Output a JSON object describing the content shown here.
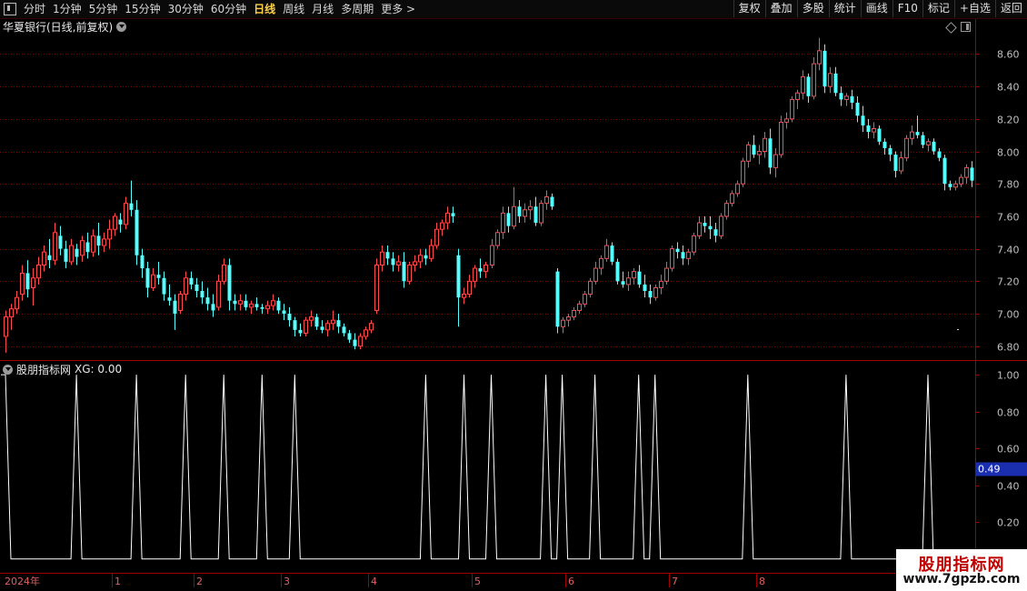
{
  "toolbar": {
    "periods": [
      "分时",
      "1分钟",
      "5分钟",
      "15分钟",
      "30分钟",
      "60分钟",
      "日线",
      "周线",
      "月线",
      "多周期",
      "更多 >"
    ],
    "active_period": "日线",
    "buttons": [
      "复权",
      "叠加",
      "多股",
      "统计",
      "画线",
      "F10",
      "标记",
      "+自选",
      "返回"
    ]
  },
  "main_panel": {
    "title": "华夏银行(日线,前复权)"
  },
  "indicator_panel": {
    "name": "股朋指标网",
    "value_label": "XG: 0.00",
    "current_value": "0.49"
  },
  "watermark": {
    "title": "股朋指标网",
    "url": "www.7gpzb.com"
  },
  "colors": {
    "up": "#ff4b4b",
    "down": "#54ffff",
    "grid": "#7a0000",
    "axis_text": "#c0c0c0",
    "signal": "#ffffff",
    "value_badge": "#1a2fb0"
  },
  "chart_data": [
    {
      "type": "candlestick",
      "title": "华夏银行(日线,前复权)",
      "y_ticks": [
        "8.60",
        "8.40",
        "8.20",
        "8.00",
        "7.80",
        "7.60",
        "7.40",
        "7.20",
        "7.00",
        "6.80"
      ],
      "ylim": [
        6.72,
        8.72
      ],
      "grid": true,
      "ohlc": [
        [
          6.86,
          7.02,
          6.76,
          6.98
        ],
        [
          6.98,
          7.06,
          6.9,
          7.03
        ],
        [
          7.03,
          7.14,
          7.0,
          7.1
        ],
        [
          7.12,
          7.3,
          7.08,
          7.25
        ],
        [
          7.25,
          7.33,
          7.1,
          7.15
        ],
        [
          7.16,
          7.28,
          7.05,
          7.22
        ],
        [
          7.22,
          7.35,
          7.18,
          7.3
        ],
        [
          7.3,
          7.42,
          7.26,
          7.38
        ],
        [
          7.36,
          7.46,
          7.28,
          7.33
        ],
        [
          7.33,
          7.56,
          7.3,
          7.5
        ],
        [
          7.48,
          7.54,
          7.36,
          7.4
        ],
        [
          7.4,
          7.45,
          7.28,
          7.32
        ],
        [
          7.32,
          7.46,
          7.3,
          7.42
        ],
        [
          7.4,
          7.43,
          7.3,
          7.35
        ],
        [
          7.36,
          7.48,
          7.32,
          7.45
        ],
        [
          7.44,
          7.5,
          7.34,
          7.38
        ],
        [
          7.38,
          7.52,
          7.35,
          7.48
        ],
        [
          7.48,
          7.56,
          7.36,
          7.42
        ],
        [
          7.42,
          7.5,
          7.38,
          7.46
        ],
        [
          7.46,
          7.58,
          7.4,
          7.52
        ],
        [
          7.52,
          7.62,
          7.48,
          7.6
        ],
        [
          7.58,
          7.62,
          7.5,
          7.55
        ],
        [
          7.55,
          7.72,
          7.52,
          7.68
        ],
        [
          7.68,
          7.82,
          7.6,
          7.64
        ],
        [
          7.64,
          7.7,
          7.3,
          7.36
        ],
        [
          7.36,
          7.4,
          7.22,
          7.28
        ],
        [
          7.28,
          7.32,
          7.1,
          7.16
        ],
        [
          7.16,
          7.28,
          7.14,
          7.24
        ],
        [
          7.24,
          7.32,
          7.18,
          7.22
        ],
        [
          7.22,
          7.26,
          7.08,
          7.12
        ],
        [
          7.1,
          7.18,
          7.05,
          7.08
        ],
        [
          7.08,
          7.12,
          6.9,
          7.0
        ],
        [
          7.02,
          7.14,
          7.0,
          7.12
        ],
        [
          7.12,
          7.26,
          7.08,
          7.22
        ],
        [
          7.22,
          7.26,
          7.15,
          7.18
        ],
        [
          7.18,
          7.22,
          7.1,
          7.14
        ],
        [
          7.14,
          7.2,
          7.06,
          7.1
        ],
        [
          7.1,
          7.16,
          7.02,
          7.06
        ],
        [
          7.06,
          7.12,
          6.98,
          7.02
        ],
        [
          7.04,
          7.24,
          7.02,
          7.2
        ],
        [
          7.2,
          7.34,
          7.18,
          7.3
        ],
        [
          7.3,
          7.34,
          7.02,
          7.08
        ],
        [
          7.08,
          7.12,
          7.02,
          7.06
        ],
        [
          7.06,
          7.12,
          7.02,
          7.08
        ],
        [
          7.08,
          7.12,
          7.02,
          7.04
        ],
        [
          7.04,
          7.08,
          7.0,
          7.06
        ],
        [
          7.06,
          7.1,
          7.02,
          7.04
        ],
        [
          7.04,
          7.06,
          7.0,
          7.03
        ],
        [
          7.03,
          7.08,
          7.0,
          7.05
        ],
        [
          7.05,
          7.12,
          7.02,
          7.08
        ],
        [
          7.08,
          7.1,
          7.0,
          7.02
        ],
        [
          7.02,
          7.06,
          6.96,
          7.0
        ],
        [
          7.0,
          7.04,
          6.92,
          6.96
        ],
        [
          6.96,
          6.98,
          6.86,
          6.9
        ],
        [
          6.9,
          6.94,
          6.86,
          6.88
        ],
        [
          6.88,
          6.98,
          6.86,
          6.96
        ],
        [
          6.96,
          7.02,
          6.92,
          6.98
        ],
        [
          6.98,
          7.0,
          6.9,
          6.92
        ],
        [
          6.92,
          6.96,
          6.88,
          6.9
        ],
        [
          6.9,
          6.96,
          6.86,
          6.94
        ],
        [
          6.94,
          7.02,
          6.9,
          6.96
        ],
        [
          6.96,
          7.0,
          6.88,
          6.92
        ],
        [
          6.92,
          6.94,
          6.86,
          6.88
        ],
        [
          6.88,
          6.9,
          6.82,
          6.84
        ],
        [
          6.84,
          6.88,
          6.78,
          6.8
        ],
        [
          6.8,
          6.88,
          6.78,
          6.86
        ],
        [
          6.86,
          6.92,
          6.84,
          6.9
        ],
        [
          6.9,
          6.96,
          6.88,
          6.94
        ],
        [
          7.02,
          7.34,
          7.0,
          7.3
        ],
        [
          7.3,
          7.42,
          7.26,
          7.38
        ],
        [
          7.38,
          7.42,
          7.3,
          7.34
        ],
        [
          7.34,
          7.38,
          7.26,
          7.3
        ],
        [
          7.3,
          7.36,
          7.26,
          7.32
        ],
        [
          7.32,
          7.38,
          7.16,
          7.2
        ],
        [
          7.2,
          7.32,
          7.18,
          7.3
        ],
        [
          7.3,
          7.36,
          7.26,
          7.32
        ],
        [
          7.32,
          7.4,
          7.28,
          7.36
        ],
        [
          7.36,
          7.4,
          7.3,
          7.34
        ],
        [
          7.34,
          7.46,
          7.32,
          7.42
        ],
        [
          7.42,
          7.56,
          7.4,
          7.52
        ],
        [
          7.52,
          7.58,
          7.48,
          7.56
        ],
        [
          7.56,
          7.66,
          7.52,
          7.62
        ],
        [
          7.62,
          7.66,
          7.56,
          7.6
        ],
        [
          7.36,
          7.4,
          6.92,
          7.1
        ],
        [
          7.1,
          7.16,
          7.06,
          7.12
        ],
        [
          7.12,
          7.24,
          7.1,
          7.2
        ],
        [
          7.2,
          7.3,
          7.16,
          7.28
        ],
        [
          7.28,
          7.34,
          7.22,
          7.26
        ],
        [
          7.26,
          7.32,
          7.22,
          7.3
        ],
        [
          7.3,
          7.46,
          7.28,
          7.42
        ],
        [
          7.42,
          7.52,
          7.4,
          7.5
        ],
        [
          7.5,
          7.66,
          7.46,
          7.62
        ],
        [
          7.62,
          7.66,
          7.5,
          7.54
        ],
        [
          7.54,
          7.78,
          7.52,
          7.66
        ],
        [
          7.66,
          7.7,
          7.56,
          7.6
        ],
        [
          7.6,
          7.68,
          7.56,
          7.64
        ],
        [
          7.64,
          7.7,
          7.58,
          7.66
        ],
        [
          7.66,
          7.72,
          7.54,
          7.56
        ],
        [
          7.56,
          7.7,
          7.54,
          7.68
        ],
        [
          7.68,
          7.76,
          7.64,
          7.72
        ],
        [
          7.72,
          7.74,
          7.64,
          7.66
        ],
        [
          7.26,
          7.28,
          6.88,
          6.92
        ],
        [
          6.92,
          6.98,
          6.88,
          6.96
        ],
        [
          6.96,
          7.0,
          6.92,
          6.98
        ],
        [
          6.98,
          7.04,
          6.96,
          7.02
        ],
        [
          7.02,
          7.08,
          7.0,
          7.06
        ],
        [
          7.06,
          7.14,
          7.04,
          7.12
        ],
        [
          7.12,
          7.22,
          7.1,
          7.2
        ],
        [
          7.2,
          7.32,
          7.18,
          7.28
        ],
        [
          7.28,
          7.36,
          7.24,
          7.34
        ],
        [
          7.34,
          7.46,
          7.32,
          7.42
        ],
        [
          7.42,
          7.44,
          7.3,
          7.32
        ],
        [
          7.32,
          7.34,
          7.18,
          7.2
        ],
        [
          7.2,
          7.26,
          7.16,
          7.18
        ],
        [
          7.18,
          7.26,
          7.14,
          7.22
        ],
        [
          7.22,
          7.28,
          7.18,
          7.26
        ],
        [
          7.26,
          7.3,
          7.16,
          7.18
        ],
        [
          7.18,
          7.24,
          7.1,
          7.14
        ],
        [
          7.14,
          7.18,
          7.06,
          7.1
        ],
        [
          7.1,
          7.18,
          7.08,
          7.16
        ],
        [
          7.16,
          7.24,
          7.12,
          7.2
        ],
        [
          7.2,
          7.32,
          7.18,
          7.28
        ],
        [
          7.28,
          7.42,
          7.26,
          7.4
        ],
        [
          7.4,
          7.44,
          7.34,
          7.38
        ],
        [
          7.38,
          7.42,
          7.3,
          7.34
        ],
        [
          7.34,
          7.4,
          7.3,
          7.38
        ],
        [
          7.38,
          7.5,
          7.36,
          7.48
        ],
        [
          7.48,
          7.6,
          7.46,
          7.56
        ],
        [
          7.56,
          7.6,
          7.5,
          7.54
        ],
        [
          7.54,
          7.6,
          7.46,
          7.52
        ],
        [
          7.52,
          7.56,
          7.44,
          7.48
        ],
        [
          7.48,
          7.62,
          7.46,
          7.6
        ],
        [
          7.6,
          7.7,
          7.58,
          7.68
        ],
        [
          7.68,
          7.76,
          7.66,
          7.74
        ],
        [
          7.74,
          7.82,
          7.72,
          7.8
        ],
        [
          7.8,
          7.96,
          7.78,
          7.94
        ],
        [
          7.94,
          8.06,
          7.9,
          8.04
        ],
        [
          8.04,
          8.1,
          7.96,
          7.98
        ],
        [
          7.98,
          8.04,
          7.92,
          8.0
        ],
        [
          8.0,
          8.12,
          7.96,
          8.08
        ],
        [
          8.08,
          8.14,
          7.86,
          7.9
        ],
        [
          7.9,
          8.02,
          7.84,
          7.98
        ],
        [
          7.98,
          8.22,
          7.96,
          8.18
        ],
        [
          8.18,
          8.24,
          8.14,
          8.2
        ],
        [
          8.2,
          8.34,
          8.18,
          8.32
        ],
        [
          8.32,
          8.38,
          8.26,
          8.36
        ],
        [
          8.36,
          8.5,
          8.32,
          8.46
        ],
        [
          8.46,
          8.48,
          8.3,
          8.34
        ],
        [
          8.34,
          8.58,
          8.32,
          8.54
        ],
        [
          8.54,
          8.7,
          8.5,
          8.62
        ],
        [
          8.62,
          8.66,
          8.36,
          8.4
        ],
        [
          8.4,
          8.52,
          8.36,
          8.48
        ],
        [
          8.48,
          8.52,
          8.34,
          8.36
        ],
        [
          8.36,
          8.4,
          8.28,
          8.32
        ],
        [
          8.32,
          8.36,
          8.28,
          8.34
        ],
        [
          8.34,
          8.38,
          8.26,
          8.3
        ],
        [
          8.3,
          8.34,
          8.18,
          8.22
        ],
        [
          8.22,
          8.28,
          8.12,
          8.16
        ],
        [
          8.16,
          8.2,
          8.08,
          8.12
        ],
        [
          8.12,
          8.18,
          8.08,
          8.14
        ],
        [
          8.14,
          8.16,
          8.04,
          8.06
        ],
        [
          8.06,
          8.08,
          7.98,
          8.02
        ],
        [
          8.02,
          8.04,
          7.94,
          7.98
        ],
        [
          7.98,
          8.0,
          7.84,
          7.88
        ],
        [
          7.88,
          8.0,
          7.86,
          7.96
        ],
        [
          7.96,
          8.1,
          7.94,
          8.08
        ],
        [
          8.08,
          8.16,
          8.04,
          8.12
        ],
        [
          8.12,
          8.22,
          8.08,
          8.1
        ],
        [
          8.1,
          8.12,
          8.02,
          8.04
        ],
        [
          8.04,
          8.08,
          8.0,
          8.06
        ],
        [
          8.06,
          8.08,
          7.98,
          8.0
        ],
        [
          8.0,
          8.02,
          7.94,
          7.96
        ],
        [
          7.96,
          7.98,
          7.76,
          7.8
        ],
        [
          7.8,
          7.82,
          7.76,
          7.78
        ],
        [
          7.78,
          7.82,
          7.76,
          7.8
        ],
        [
          7.8,
          7.86,
          7.78,
          7.84
        ],
        [
          7.84,
          7.92,
          7.8,
          7.9
        ],
        [
          7.9,
          7.94,
          7.78,
          7.82
        ]
      ]
    },
    {
      "type": "line",
      "title": "XG",
      "y_ticks": [
        "1.00",
        "0.80",
        "0.60",
        "0.40",
        "0.20"
      ],
      "ylim": [
        -0.06,
        1.04
      ],
      "x_labels": [
        "2024年",
        "1",
        "2",
        "3",
        "4",
        "5",
        "6",
        "7",
        "8"
      ],
      "signal_days": [
        0,
        13,
        24,
        33,
        40,
        47,
        53,
        77,
        84,
        89,
        99,
        102,
        108,
        116,
        119,
        136,
        154,
        169
      ],
      "series": [
        {
          "values_default": 0,
          "signal_value": 1
        }
      ]
    }
  ]
}
